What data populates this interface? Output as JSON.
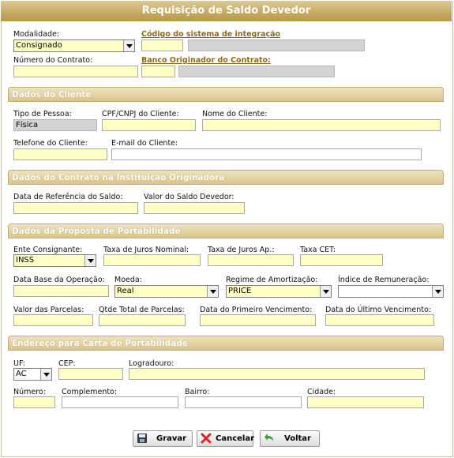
{
  "title": "Requisição de Saldo Devedor",
  "top": {
    "modalidade_label": "Modalidade:",
    "modalidade_value": "Consignado",
    "codigo_sistema_label": "Código do sistema de integração",
    "numero_contrato_label": "Número do Contrato:",
    "banco_originador_label": "Banco Originador do Contrato:"
  },
  "cliente": {
    "section_title": "Dados do Cliente",
    "tipo_pessoa_label": "Tipo de Pessoa:",
    "tipo_pessoa_value": "Física",
    "cpf_label": "CPF/CNPJ do Cliente:",
    "nome_label": "Nome do Cliente:",
    "telefone_label": "Telefone do Cliente:",
    "email_label": "E-mail do Cliente:"
  },
  "contrato": {
    "section_title": "Dados do Contrato na Instituição Originadora",
    "data_ref_label": "Data de Referência do Saldo:",
    "valor_saldo_label": "Valor do Saldo Devedor:"
  },
  "proposta": {
    "section_title": "Dados da Proposta de Portabilidade",
    "ente_label": "Ente Consignante:",
    "ente_value": "INSS",
    "taxa_nominal_label": "Taxa de Juros Nominal:",
    "taxa_ap_label": "Taxa de Juros Ap.:",
    "taxa_cet_label": "Taxa CET:",
    "data_base_label": "Data Base da Operação:",
    "moeda_label": "Moeda:",
    "moeda_value": "Real",
    "regime_label": "Regime de Amortização:",
    "regime_value": "PRICE",
    "indice_label": "Índice de Remuneração:",
    "indice_value": "",
    "valor_parcelas_label": "Valor das Parcelas:",
    "qtde_parcelas_label": "Qtde Total de Parcelas:",
    "data_primeiro_label": "Data do Primeiro Vencimento:",
    "data_ultimo_label": "Data do Último Vencimento:"
  },
  "endereco": {
    "section_title": "Endereço para Carta de Portabilidade",
    "uf_label": "UF:",
    "uf_value": "AC",
    "cep_label": "CEP:",
    "logradouro_label": "Logradouro:",
    "numero_label": "Número:",
    "complemento_label": "Complemento:",
    "bairro_label": "Bairro:",
    "cidade_label": "Cidade:"
  },
  "buttons": {
    "gravar": "Gravar",
    "cancelar": "Cancelar",
    "voltar": "Voltar"
  },
  "colors": {
    "title_bar": "#c4a860",
    "section_bar": "#d9c48d",
    "required_field": "#ffffc6",
    "disabled_field": "#d4d4d4",
    "link_label": "#8b6a1a"
  },
  "icons": [
    "save-icon",
    "cancel-icon",
    "back-arrow-icon",
    "dropdown-arrow-icon"
  ]
}
